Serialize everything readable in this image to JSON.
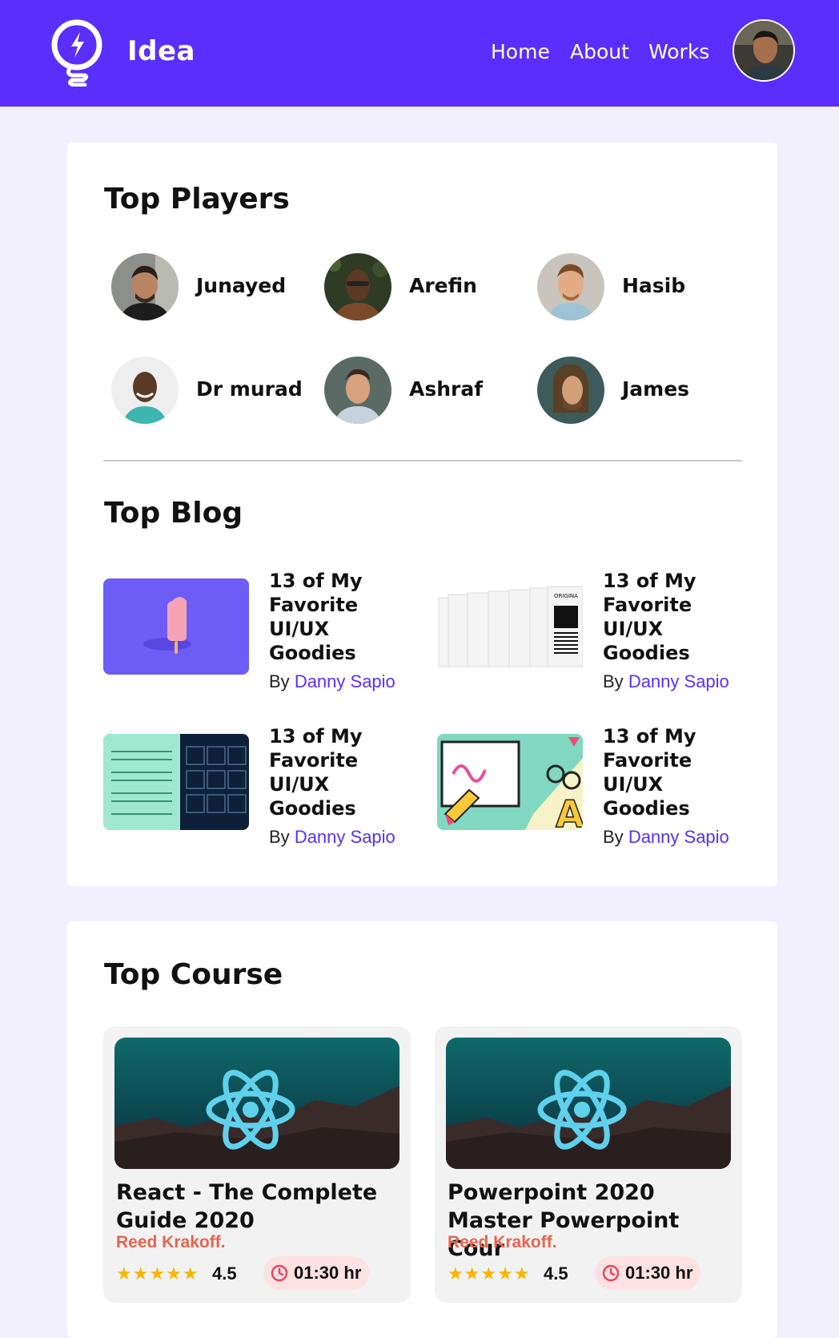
{
  "header": {
    "brand": "Idea",
    "nav": [
      "Home",
      "About",
      "Works"
    ],
    "bg_color": "#5a2efc",
    "logo_icon": "lightbulb-icon"
  },
  "players": {
    "title": "Top Players",
    "items": [
      {
        "name": "Junayed"
      },
      {
        "name": "Arefin"
      },
      {
        "name": "Hasib"
      },
      {
        "name": "Dr murad"
      },
      {
        "name": "Ashraf"
      },
      {
        "name": "James"
      }
    ]
  },
  "blog": {
    "title": "Top Blog",
    "items": [
      {
        "title": "13 of My Favorite UI/UX Goodies",
        "by": "By",
        "author": "Danny Sapio",
        "thumb": "popsicle"
      },
      {
        "title": "13 of My Favorite UI/UX Goodies",
        "by": "By",
        "author": "Danny Sapio",
        "thumb": "papers"
      },
      {
        "title": "13 of My Favorite UI/UX Goodies",
        "by": "By",
        "author": "Danny Sapio",
        "thumb": "wireframe"
      },
      {
        "title": "13 of My Favorite UI/UX Goodies",
        "by": "By",
        "author": "Danny Sapio",
        "thumb": "craft"
      }
    ],
    "author_color": "#5a2efc"
  },
  "courses": {
    "title": "Top Course",
    "items": [
      {
        "title": "React - The Complete Guide 2020",
        "teacher": "Reed Krakoff.",
        "stars": "★★★★★",
        "rating": "4.5",
        "time": "01:30 hr"
      },
      {
        "title": "Powerpoint 2020 Master Powerpoint Cour",
        "teacher": "Reed Krakoff.",
        "stars": "★★★★★",
        "rating": "4.5",
        "time": "01:30 hr"
      }
    ],
    "teacher_color": "#e8644e",
    "star_color": "#f8b500"
  }
}
